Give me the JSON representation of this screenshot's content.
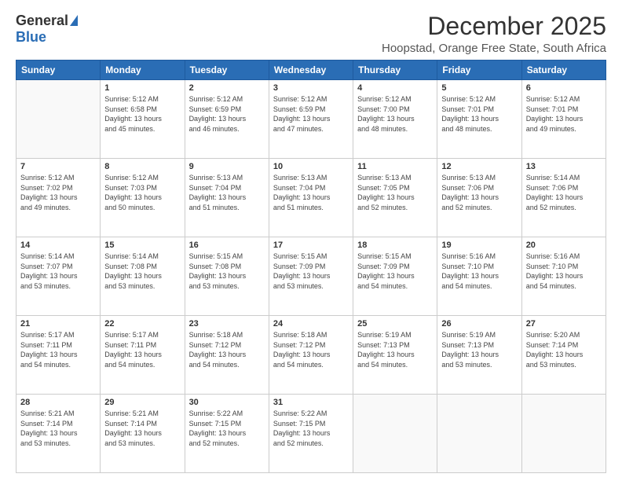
{
  "header": {
    "logo_general": "General",
    "logo_blue": "Blue",
    "month_title": "December 2025",
    "location": "Hoopstad, Orange Free State, South Africa"
  },
  "days_of_week": [
    "Sunday",
    "Monday",
    "Tuesday",
    "Wednesday",
    "Thursday",
    "Friday",
    "Saturday"
  ],
  "weeks": [
    [
      {
        "day": "",
        "info": ""
      },
      {
        "day": "1",
        "info": "Sunrise: 5:12 AM\nSunset: 6:58 PM\nDaylight: 13 hours\nand 45 minutes."
      },
      {
        "day": "2",
        "info": "Sunrise: 5:12 AM\nSunset: 6:59 PM\nDaylight: 13 hours\nand 46 minutes."
      },
      {
        "day": "3",
        "info": "Sunrise: 5:12 AM\nSunset: 6:59 PM\nDaylight: 13 hours\nand 47 minutes."
      },
      {
        "day": "4",
        "info": "Sunrise: 5:12 AM\nSunset: 7:00 PM\nDaylight: 13 hours\nand 48 minutes."
      },
      {
        "day": "5",
        "info": "Sunrise: 5:12 AM\nSunset: 7:01 PM\nDaylight: 13 hours\nand 48 minutes."
      },
      {
        "day": "6",
        "info": "Sunrise: 5:12 AM\nSunset: 7:01 PM\nDaylight: 13 hours\nand 49 minutes."
      }
    ],
    [
      {
        "day": "7",
        "info": "Sunrise: 5:12 AM\nSunset: 7:02 PM\nDaylight: 13 hours\nand 49 minutes."
      },
      {
        "day": "8",
        "info": "Sunrise: 5:12 AM\nSunset: 7:03 PM\nDaylight: 13 hours\nand 50 minutes."
      },
      {
        "day": "9",
        "info": "Sunrise: 5:13 AM\nSunset: 7:04 PM\nDaylight: 13 hours\nand 51 minutes."
      },
      {
        "day": "10",
        "info": "Sunrise: 5:13 AM\nSunset: 7:04 PM\nDaylight: 13 hours\nand 51 minutes."
      },
      {
        "day": "11",
        "info": "Sunrise: 5:13 AM\nSunset: 7:05 PM\nDaylight: 13 hours\nand 52 minutes."
      },
      {
        "day": "12",
        "info": "Sunrise: 5:13 AM\nSunset: 7:06 PM\nDaylight: 13 hours\nand 52 minutes."
      },
      {
        "day": "13",
        "info": "Sunrise: 5:14 AM\nSunset: 7:06 PM\nDaylight: 13 hours\nand 52 minutes."
      }
    ],
    [
      {
        "day": "14",
        "info": "Sunrise: 5:14 AM\nSunset: 7:07 PM\nDaylight: 13 hours\nand 53 minutes."
      },
      {
        "day": "15",
        "info": "Sunrise: 5:14 AM\nSunset: 7:08 PM\nDaylight: 13 hours\nand 53 minutes."
      },
      {
        "day": "16",
        "info": "Sunrise: 5:15 AM\nSunset: 7:08 PM\nDaylight: 13 hours\nand 53 minutes."
      },
      {
        "day": "17",
        "info": "Sunrise: 5:15 AM\nSunset: 7:09 PM\nDaylight: 13 hours\nand 53 minutes."
      },
      {
        "day": "18",
        "info": "Sunrise: 5:15 AM\nSunset: 7:09 PM\nDaylight: 13 hours\nand 54 minutes."
      },
      {
        "day": "19",
        "info": "Sunrise: 5:16 AM\nSunset: 7:10 PM\nDaylight: 13 hours\nand 54 minutes."
      },
      {
        "day": "20",
        "info": "Sunrise: 5:16 AM\nSunset: 7:10 PM\nDaylight: 13 hours\nand 54 minutes."
      }
    ],
    [
      {
        "day": "21",
        "info": "Sunrise: 5:17 AM\nSunset: 7:11 PM\nDaylight: 13 hours\nand 54 minutes."
      },
      {
        "day": "22",
        "info": "Sunrise: 5:17 AM\nSunset: 7:11 PM\nDaylight: 13 hours\nand 54 minutes."
      },
      {
        "day": "23",
        "info": "Sunrise: 5:18 AM\nSunset: 7:12 PM\nDaylight: 13 hours\nand 54 minutes."
      },
      {
        "day": "24",
        "info": "Sunrise: 5:18 AM\nSunset: 7:12 PM\nDaylight: 13 hours\nand 54 minutes."
      },
      {
        "day": "25",
        "info": "Sunrise: 5:19 AM\nSunset: 7:13 PM\nDaylight: 13 hours\nand 54 minutes."
      },
      {
        "day": "26",
        "info": "Sunrise: 5:19 AM\nSunset: 7:13 PM\nDaylight: 13 hours\nand 53 minutes."
      },
      {
        "day": "27",
        "info": "Sunrise: 5:20 AM\nSunset: 7:14 PM\nDaylight: 13 hours\nand 53 minutes."
      }
    ],
    [
      {
        "day": "28",
        "info": "Sunrise: 5:21 AM\nSunset: 7:14 PM\nDaylight: 13 hours\nand 53 minutes."
      },
      {
        "day": "29",
        "info": "Sunrise: 5:21 AM\nSunset: 7:14 PM\nDaylight: 13 hours\nand 53 minutes."
      },
      {
        "day": "30",
        "info": "Sunrise: 5:22 AM\nSunset: 7:15 PM\nDaylight: 13 hours\nand 52 minutes."
      },
      {
        "day": "31",
        "info": "Sunrise: 5:22 AM\nSunset: 7:15 PM\nDaylight: 13 hours\nand 52 minutes."
      },
      {
        "day": "",
        "info": ""
      },
      {
        "day": "",
        "info": ""
      },
      {
        "day": "",
        "info": ""
      }
    ]
  ]
}
